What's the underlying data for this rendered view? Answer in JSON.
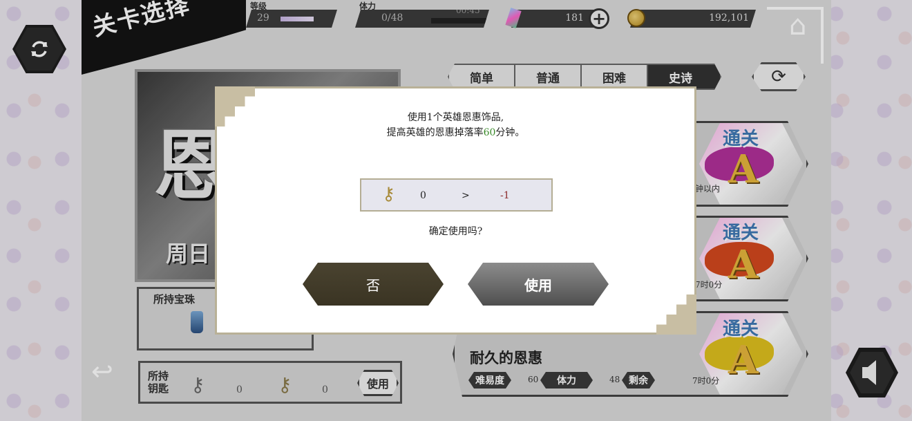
{
  "header": {
    "title": "关卡选择",
    "level_label": "等级",
    "level_value": "29",
    "stamina_label": "体力",
    "stamina_value": "0/48",
    "stamina_timer": "00:45",
    "gems_value": "181",
    "coins_value": "192,101"
  },
  "tabs": [
    {
      "label": "简单"
    },
    {
      "label": "普通"
    },
    {
      "label": "困难"
    },
    {
      "label": "史诗"
    }
  ],
  "left_panel": {
    "big_char": "恩",
    "subtitle": "周日",
    "gems_label": "所持宝珠",
    "keys_label": "所持钥匙",
    "key_counts": [
      "0",
      "0"
    ],
    "use_label": "使用"
  },
  "stages": [
    {
      "rank_clear": "通关",
      "rank": "A",
      "time": "钟以内",
      "splash_color": "#b2309a"
    },
    {
      "rank_clear": "通关",
      "rank": "A",
      "time": "7时0分",
      "splash_color": "#d4481e"
    },
    {
      "rank_clear": "通关",
      "rank": "A",
      "time": "7时0分",
      "splash_color": "#e0c11e"
    }
  ],
  "bottom_stage": {
    "name": "耐久的恩惠",
    "difficulty_label": "难易度",
    "difficulty_value": "60",
    "stamina_label": "体力",
    "stamina_value": "48",
    "remaining_label": "剩余",
    "remaining_value": "7时0分"
  },
  "modal": {
    "line1": "使用1个英雄恩惠饰品,",
    "line2_pre": "提高英雄的恩惠掉落率",
    "line2_num": "60",
    "line2_post": "分钟。",
    "from": "0",
    "arrow": ">",
    "to": "-1",
    "question": "确定使用吗?",
    "no_label": "否",
    "use_label": "使用"
  },
  "colors": {
    "accent_dark": "#3a3423",
    "use_btn": "#6b6b6b",
    "highlight": "#3a8a2a",
    "negative": "#8c2c2c"
  },
  "icons": [
    "refresh-icon",
    "home-icon",
    "plus-icon",
    "gem-icon",
    "coin-icon",
    "key-icon",
    "bottle-icon",
    "back-icon",
    "speaker-icon"
  ]
}
